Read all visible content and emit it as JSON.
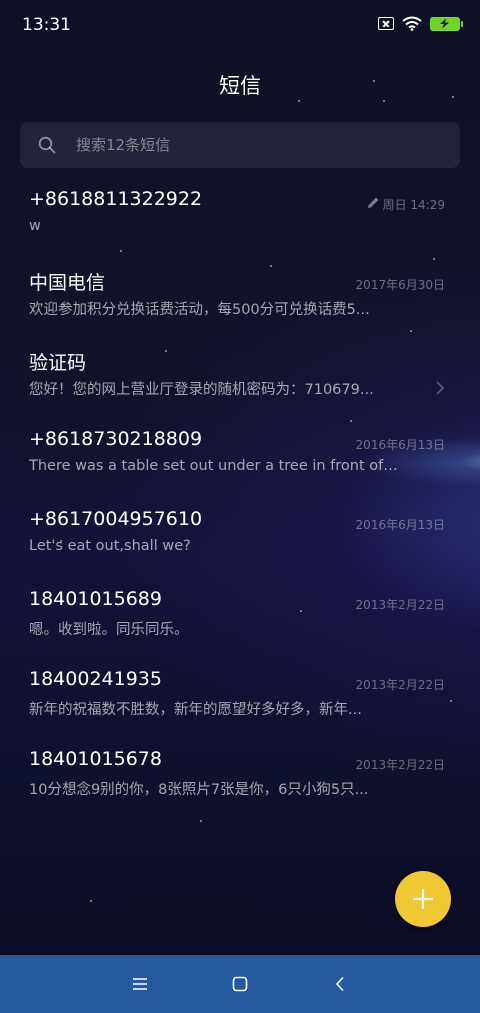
{
  "status_bar": {
    "time": "13:31",
    "icons": [
      "sim-error-icon",
      "wifi-icon",
      "battery-charging-icon"
    ],
    "battery_color": "#6fd32c"
  },
  "header": {
    "title": "短信"
  },
  "search": {
    "placeholder": "搜索12条短信"
  },
  "messages": [
    {
      "sender": "+8618811322922",
      "preview": "w",
      "date": "周日 14:29",
      "draft": true
    },
    {
      "sender": "中国电信",
      "preview": "欢迎参加积分兑换话费活动，每500分可兑换话费5...",
      "date": "2017年6月30日"
    },
    {
      "sender": "验证码",
      "preview": "您好！您的网上营业厅登录的随机密码为：710679...",
      "date": "",
      "folder": true
    },
    {
      "sender": "+8618730218809",
      "preview": "There was a table set out under a tree in front of ...",
      "date": "2016年6月13日"
    },
    {
      "sender": "+8617004957610",
      "preview": "Let's eat out,shall we?",
      "date": "2016年6月13日"
    },
    {
      "sender": "18401015689",
      "preview": "嗯。收到啦。同乐同乐。",
      "date": "2013年2月22日"
    },
    {
      "sender": "18400241935",
      "preview": "新年的祝福数不胜数，新年的愿望好多好多，新年...",
      "date": "2013年2月22日"
    },
    {
      "sender": "18401015678",
      "preview": "10分想念9别的你，8张照片7张是你，6只小狗5只...",
      "date": "2013年2月22日"
    }
  ],
  "fab": {
    "icon": "plus-icon",
    "color": "#f1c833"
  },
  "nav_bar": {
    "color": "#255a9f",
    "buttons": [
      "menu-icon",
      "home-icon",
      "back-icon"
    ]
  }
}
